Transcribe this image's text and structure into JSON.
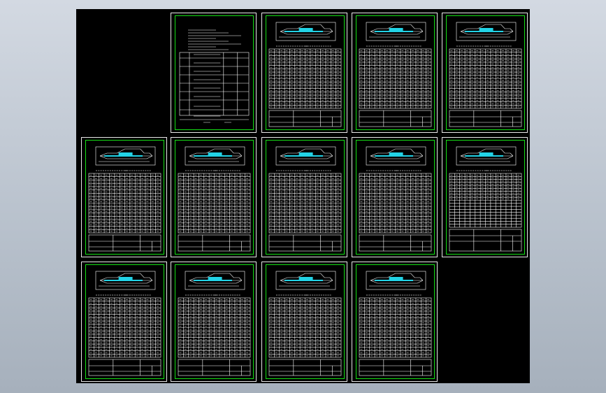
{
  "viewport": {
    "background": "#000000"
  },
  "colors": {
    "frame": "#e8e8e8",
    "border": "#14e014",
    "line": "#ffffff",
    "accent": "#22d3e6"
  },
  "drawing_set": {
    "rows": [
      [
        "cover",
        "process",
        "process",
        "process"
      ],
      [
        "process",
        "process",
        "process",
        "process",
        "process-grid"
      ],
      [
        "process",
        "process",
        "process",
        "process"
      ]
    ]
  }
}
